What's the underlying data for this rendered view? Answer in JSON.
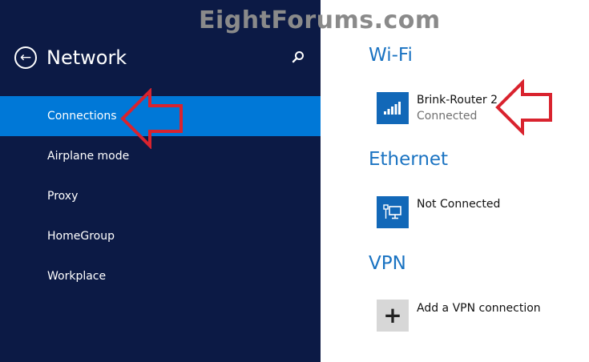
{
  "watermark": "EightForums.com",
  "left_panel": {
    "title": "Network",
    "back_icon": "back-arrow-icon",
    "search_icon": "search-icon",
    "nav": [
      {
        "label": "Connections",
        "selected": true
      },
      {
        "label": "Airplane mode",
        "selected": false
      },
      {
        "label": "Proxy",
        "selected": false
      },
      {
        "label": "HomeGroup",
        "selected": false
      },
      {
        "label": "Workplace",
        "selected": false
      }
    ]
  },
  "wifi": {
    "section_title": "Wi-Fi",
    "network_name": "Brink-Router 2",
    "status": "Connected",
    "icon": "wifi-signal-icon"
  },
  "ethernet": {
    "section_title": "Ethernet",
    "status": "Not Connected",
    "icon": "ethernet-icon"
  },
  "vpn": {
    "section_title": "VPN",
    "add_label": "Add a VPN connection",
    "icon": "plus-icon"
  },
  "colors": {
    "left_bg": "#0c1a45",
    "selected_bg": "#0078d7",
    "accent_blue": "#1a73c2",
    "tile_blue": "#1268b8",
    "annotation_red": "#d9232e"
  }
}
